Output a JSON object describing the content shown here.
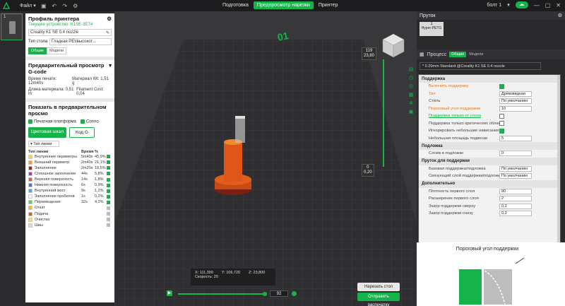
{
  "topbar": {
    "file_label": "Файл",
    "tabs": [
      "Подготовка",
      "Предпросмотр нарезки",
      "Принтер"
    ],
    "active_tab": 1,
    "user": "болт 1"
  },
  "plate": {
    "number": "1"
  },
  "printer": {
    "title": "Профиль принтера",
    "device": "Текущее устройство: K1SE-3E74",
    "model": "Creality K1 SE 0.4 nozzle",
    "bed_label": "Тип стола",
    "bed_value": "Гладкая PEI/высокот...",
    "tabs": [
      "Общие",
      "Модели"
    ]
  },
  "gcode": {
    "title": "Предварительный просмотр G-code",
    "print_time_label": "Время печати:",
    "print_time": "12m40s",
    "material_label": "Материал Wt:",
    "material": "1,51 g",
    "length_label": "Длина материала:",
    "length": "0,51 m",
    "cost_label": "Filament Cost:",
    "cost": "0,04"
  },
  "show": {
    "title": "Показать в предварительном просмо",
    "checks": [
      "Печатная платформа",
      "Сопло"
    ],
    "btn_color": "Цветовая шкал",
    "btn_gcode": "Код G",
    "legend_select": "Тип линии",
    "headers": [
      "Тип линии",
      "Время",
      "%"
    ]
  },
  "legend": [
    {
      "name": "Внутренние периметры",
      "time": "5m49s",
      "pct": "45,9%",
      "color": "#f5d547"
    },
    {
      "name": "Внешний периметр",
      "time": "2m40s",
      "pct": "21,1%",
      "color": "#f59b2b"
    },
    {
      "name": "Заполнение",
      "time": "2m20s",
      "pct": "18,5%",
      "color": "#a3221f"
    },
    {
      "name": "Сплошное заполнение",
      "time": "44s",
      "pct": "5,8%",
      "color": "#9b3fc8"
    },
    {
      "name": "Верхняя поверхность",
      "time": "14s",
      "pct": "1,8%",
      "color": "#e8574b"
    },
    {
      "name": "Нижняя поверхность",
      "time": "6s",
      "pct": "0,9%",
      "color": "#4b6edc"
    },
    {
      "name": "Внутренний мост",
      "time": "9s",
      "pct": "1,2%",
      "color": "#4aa9e0"
    },
    {
      "name": "Заполнение пробелов",
      "time": "1s",
      "pct": "0,2%",
      "color": "#ffffff"
    },
    {
      "name": "Перемещения",
      "time": "32s",
      "pct": "4,2%",
      "color": "#5ad64a"
    },
    {
      "name": "Откат",
      "time": "",
      "pct": "",
      "color": "#e0c22a"
    },
    {
      "name": "Подача",
      "time": "",
      "pct": "",
      "color": "#e05f1a"
    },
    {
      "name": "Очистка",
      "time": "",
      "pct": "",
      "color": "#f0e060"
    },
    {
      "name": "Швы",
      "time": "",
      "pct": "",
      "color": "#dddddd"
    }
  ],
  "viewport": {
    "top_tag_a": "119",
    "top_tag_b": "23,80",
    "bottom_tag_a": "0",
    "bottom_tag_b": "0,20",
    "coords": {
      "x": "X: 111,399",
      "y": "Y: 106,720",
      "z": "Z: 23,800",
      "speed": "Скорость: 20"
    },
    "layer_value": "92",
    "btn_slice": "Нарезать стол",
    "btn_send": "Отправить распечатку",
    "plate_label": "01"
  },
  "right": {
    "filament_title": "Пруток",
    "filament_num": "1",
    "filament_name": "Hyper-PETG",
    "process_title": "Процесс",
    "process_tabs": [
      "Общие",
      "Модели"
    ],
    "preset": "* 0.20mm  Standard @Creality K1 SE 0.4 nozzle",
    "support_header": "Поддержка",
    "rows": [
      {
        "label": "Включить поддержку",
        "type": "check",
        "on": true,
        "cls": "o"
      },
      {
        "label": "Тип",
        "type": "val",
        "value": "Древовидная ...",
        "cls": "o"
      },
      {
        "label": "Стиль",
        "type": "val",
        "value": "По умолчанию",
        "cls": ""
      },
      {
        "label": "Пороговый угол поддержки",
        "type": "val",
        "value": "10",
        "cls": "o"
      },
      {
        "label": "Поддержка только от стола",
        "type": "check",
        "on": false,
        "cls": "g"
      },
      {
        "label": "Поддержка только критических областей",
        "type": "check",
        "on": false,
        "cls": ""
      },
      {
        "label": "Игнорировать небольшие нависания",
        "type": "check",
        "on": true,
        "cls": ""
      },
      {
        "label": "Небольшая площадь подвески",
        "type": "val",
        "value": "5",
        "cls": ""
      }
    ],
    "raft_header": "Подложка",
    "raft_rows": [
      {
        "label": "Слоёв в подложке",
        "value": "0"
      }
    ],
    "filament_support_header": "Пруток для поддержки",
    "fs_rows": [
      {
        "label": "Базовая поддержка/подложка",
        "value": "По умолчанию"
      },
      {
        "label": "Связующий слой поддержки/подложки",
        "value": "По умолчанию"
      }
    ],
    "advanced_header": "Дополнительно",
    "adv_rows": [
      {
        "label": "Плотность первого слоя",
        "value": "90"
      },
      {
        "label": "Расширение первого слоя",
        "value": "2"
      },
      {
        "label": "Зазор поддержки сверху",
        "value": "0,2"
      },
      {
        "label": "Зазор поддержки снизу",
        "value": "0,2"
      }
    ],
    "preview_title": "Пороговый угол поддержки"
  }
}
